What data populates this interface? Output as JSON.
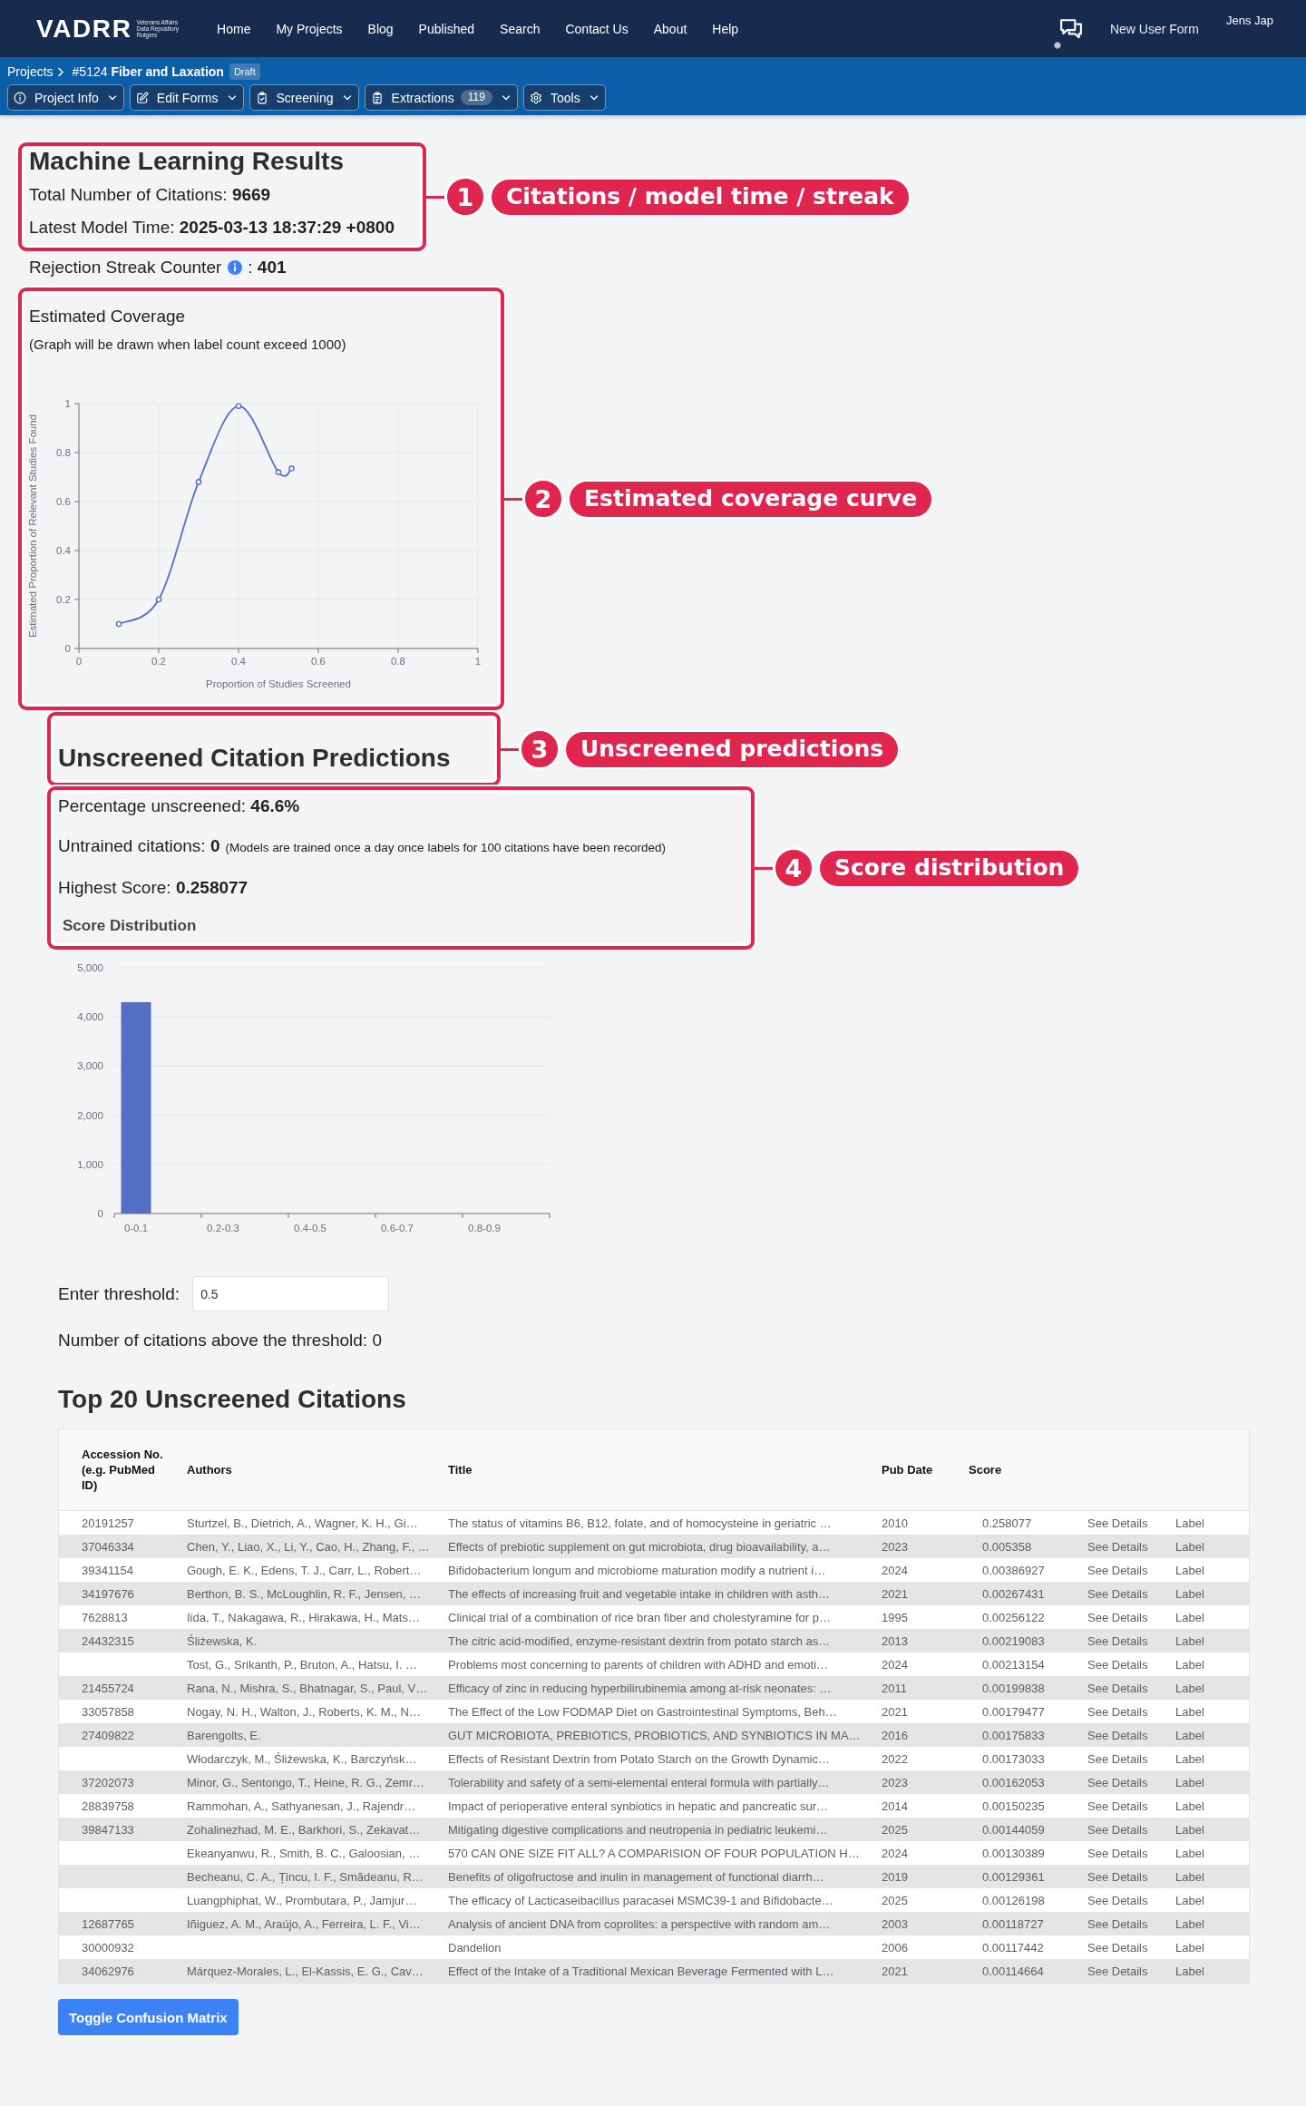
{
  "navbar": {
    "logo": "VADRR",
    "tagline": [
      "Veterans Affairs",
      "Data Repository",
      "Rutgers"
    ],
    "links": [
      {
        "label": "Home"
      },
      {
        "label": "My Projects"
      },
      {
        "label": "Blog"
      },
      {
        "label": "Published"
      },
      {
        "label": "Search"
      },
      {
        "label": "Contact Us"
      },
      {
        "label": "About"
      },
      {
        "label": "Help"
      }
    ],
    "right_links": [
      "New User Form"
    ],
    "user": "Jens Jap"
  },
  "project_bar": {
    "breadcrumb": "Projects",
    "project": "#5124 **Fiber and Laxation**",
    "status": "Draft",
    "menus": [
      {
        "label": "Project Info"
      },
      {
        "label": "Edit Forms"
      },
      {
        "label": "Screening"
      },
      {
        "label": "Extractions",
        "count": "119"
      },
      {
        "label": "Tools"
      }
    ]
  },
  "ml_results": {
    "title": "Machine Learning Results",
    "lines": [
      {
        "text": "Total Number of Citations: **9669**"
      },
      {
        "text": "Latest Model Time: **2025-03-13 18:37:29 +0800**"
      }
    ],
    "rejection_streak": {
      "label": "Rejection Streak Counter",
      "info": true,
      "value": ": **401**"
    }
  },
  "coverage": {
    "title": "Estimated Coverage",
    "note": "(Graph will be drawn when label count exceed 1000)",
    "chart_data": {
      "type": "line",
      "xlabel": "Proportion of Studies Screened",
      "ylabel": "Estimated Proportion of Relevant Studies Found",
      "x": [
        0.1,
        0.2,
        0.3,
        0.4,
        0.5,
        0.533
      ],
      "series": [
        {
          "color": "#5470c6",
          "marker": "circle",
          "values": [
            0.1,
            0.2,
            0.68,
            0.99,
            0.72,
            0.735
          ]
        }
      ],
      "xlim": [
        0,
        1
      ],
      "ylim": [
        0,
        1
      ],
      "xticks": [
        0,
        0.2,
        0.4,
        0.6,
        0.8,
        1
      ],
      "yticks": [
        0,
        0.2,
        0.4,
        0.6,
        0.8,
        1
      ],
      "grid": true
    }
  },
  "predictions": {
    "title": "Unscreened Citation Predictions",
    "stats": [
      {
        "text": "Percentage unscreened: **46.6%**"
      },
      {
        "text": "Untrained citations: **0**",
        "note": "(Models are trained once a day once labels for 100 citations have been recorded)"
      },
      {
        "text": "Highest Score: **0.258077**"
      }
    ],
    "chart_data": {
      "type": "bar",
      "title": "Score Distribution",
      "categories": [
        "0-0.1",
        "0.2-0.3",
        "0.4-0.5",
        "0.6-0.7",
        "0.8-0.9"
      ],
      "series": [
        {
          "color": "#5470c6",
          "values": [
            4300,
            0,
            0,
            0,
            0
          ]
        }
      ],
      "ylim": [
        0,
        5000
      ],
      "yticks": [
        0,
        {
          "value": 1000,
          "label": "1,000"
        },
        {
          "value": 2000,
          "label": "2,000"
        },
        {
          "value": 3000,
          "label": "3,000"
        },
        {
          "value": 4000,
          "label": "4,000"
        },
        {
          "value": 5000,
          "label": "5,000"
        }
      ],
      "grid": true
    },
    "threshold": {
      "label": "Enter threshold:",
      "value": "0.5"
    },
    "above_threshold": "Number of citations above the threshold: 0"
  },
  "top_citations": {
    "title": "Top 20 Unscreened Citations",
    "columns": [
      "Accession No. (e.g. PubMed ID)",
      "Authors",
      "Title",
      "Pub Date",
      "Score"
    ],
    "rows": [
      {
        "accession": "20191257",
        "authors": "Sturtzel, B., Dietrich, A., Wagner, K. H., Gi…",
        "title": "The status of vitamins B6, B12, folate, and of homocysteine in geriatric …",
        "pub_date": "2010",
        "score": "0.258077",
        "details": "See Details",
        "label": "Label"
      },
      {
        "accession": "37046334",
        "authors": "Chen, Y., Liao, X., Li, Y., Cao, H., Zhang, F., …",
        "title": "Effects of prebiotic supplement on gut microbiota, drug bioavailability, a…",
        "pub_date": "2023",
        "score": "0.005358",
        "details": "See Details",
        "label": "Label"
      },
      {
        "accession": "39341154",
        "authors": "Gough, E. K., Edens, T. J., Carr, L., Robert…",
        "title": "Bifidobacterium longum and microbiome maturation modify a nutrient i…",
        "pub_date": "2024",
        "score": "0.00386927",
        "details": "See Details",
        "label": "Label"
      },
      {
        "accession": "34197676",
        "authors": "Berthon, B. S., McLoughlin, R. F., Jensen, …",
        "title": "The effects of increasing fruit and vegetable intake in children with asth…",
        "pub_date": "2021",
        "score": "0.00267431",
        "details": "See Details",
        "label": "Label"
      },
      {
        "accession": "7628813",
        "authors": "Iida, T., Nakagawa, R., Hirakawa, H., Mats…",
        "title": "Clinical trial of a combination of rice bran fiber and cholestyramine for p…",
        "pub_date": "1995",
        "score": "0.00256122",
        "details": "See Details",
        "label": "Label"
      },
      {
        "accession": "24432315",
        "authors": "Śliżewska, K.",
        "title": "The citric acid-modified, enzyme-resistant dextrin from potato starch as…",
        "pub_date": "2013",
        "score": "0.00219083",
        "details": "See Details",
        "label": "Label"
      },
      {
        "authors": "Tost, G., Srikanth, P., Bruton, A., Hatsu, I. …",
        "title": "Problems most concerning to parents of children with ADHD and emoti…",
        "pub_date": "2024",
        "score": "0.00213154",
        "details": "See Details",
        "label": "Label"
      },
      {
        "accession": "21455724",
        "authors": "Rana, N., Mishra, S., Bhatnagar, S., Paul, V…",
        "title": "Efficacy of zinc in reducing hyperbilirubinemia among at-risk neonates: …",
        "pub_date": "2011",
        "score": "0.00199838",
        "details": "See Details",
        "label": "Label"
      },
      {
        "accession": "33057858",
        "authors": "Nogay, N. H., Walton, J., Roberts, K. M., N…",
        "title": "The Effect of the Low FODMAP Diet on Gastrointestinal Symptoms, Beh…",
        "pub_date": "2021",
        "score": "0.00179477",
        "details": "See Details",
        "label": "Label"
      },
      {
        "accession": "27409822",
        "authors": "Barengolts, E.",
        "title": "GUT MICROBIOTA, PREBIOTICS, PROBIOTICS, AND SYNBIOTICS IN MA…",
        "pub_date": "2016",
        "score": "0.00175833",
        "details": "See Details",
        "label": "Label"
      },
      {
        "authors": "Włodarczyk, M., Śliżewska, K., Barczyńsk…",
        "title": "Effects of Resistant Dextrin from Potato Starch on the Growth Dynamic…",
        "pub_date": "2022",
        "score": "0.00173033",
        "details": "See Details",
        "label": "Label"
      },
      {
        "accession": "37202073",
        "authors": "Minor, G., Sentongo, T., Heine, R. G., Zemr…",
        "title": "Tolerability and safety of a semi-elemental enteral formula with partially…",
        "pub_date": "2023",
        "score": "0.00162053",
        "details": "See Details",
        "label": "Label"
      },
      {
        "accession": "28839758",
        "authors": "Rammohan, A., Sathyanesan, J., Rajendr…",
        "title": "Impact of perioperative enteral synbiotics in hepatic and pancreatic sur…",
        "pub_date": "2014",
        "score": "0.00150235",
        "details": "See Details",
        "label": "Label"
      },
      {
        "accession": "39847133",
        "authors": "Zohalinezhad, M. E., Barkhori, S., Zekavat…",
        "title": "Mitigating digestive complications and neutropenia in pediatric leukemi…",
        "pub_date": "2025",
        "score": "0.00144059",
        "details": "See Details",
        "label": "Label"
      },
      {
        "authors": "Ekeanyanwu, R., Smith, B. C., Galoosian, …",
        "title": "570 CAN ONE SIZE FIT ALL? A COMPARISION OF FOUR POPULATION H…",
        "pub_date": "2024",
        "score": "0.00130389",
        "details": "See Details",
        "label": "Label"
      },
      {
        "authors": "Becheanu, C. A., Țincu, I. F., Smădeanu, R…",
        "title": "Benefits of oligofructose and inulin in management of functional diarrh…",
        "pub_date": "2019",
        "score": "0.00129361",
        "details": "See Details",
        "label": "Label"
      },
      {
        "authors": "Luangphiphat, W., Prombutara, P., Jamjur…",
        "title": "The efficacy of Lacticaseibacillus paracasei MSMC39-1 and Bifidobacte…",
        "pub_date": "2025",
        "score": "0.00126198",
        "details": "See Details",
        "label": "Label"
      },
      {
        "accession": "12687765",
        "authors": "Iñiguez, A. M., Araújo, A., Ferreira, L. F., Vi…",
        "title": "Analysis of ancient DNA from coprolites: a perspective with random am…",
        "pub_date": "2003",
        "score": "0.00118727",
        "details": "See Details",
        "label": "Label"
      },
      {
        "accession": "30000932",
        "title": "Dandelion",
        "pub_date": "2006",
        "score": "0.00117442",
        "details": "See Details",
        "label": "Label"
      },
      {
        "accession": "34062976",
        "authors": "Márquez-Morales, L., El-Kassis, E. G., Cav…",
        "title": "Effect of the Intake of a Traditional Mexican Beverage Fermented with L…",
        "pub_date": "2021",
        "score": "0.00114664",
        "details": "See Details",
        "label": "Label"
      }
    ],
    "toggle_button": "Toggle Confusion Matrix"
  },
  "annotations": [
    {
      "number": "1",
      "label": "Citations / model time / streak"
    },
    {
      "number": "2",
      "label": "Estimated coverage curve"
    },
    {
      "number": "3",
      "label": "Unscreened predictions"
    },
    {
      "number": "4",
      "label": "Score distribution"
    }
  ]
}
